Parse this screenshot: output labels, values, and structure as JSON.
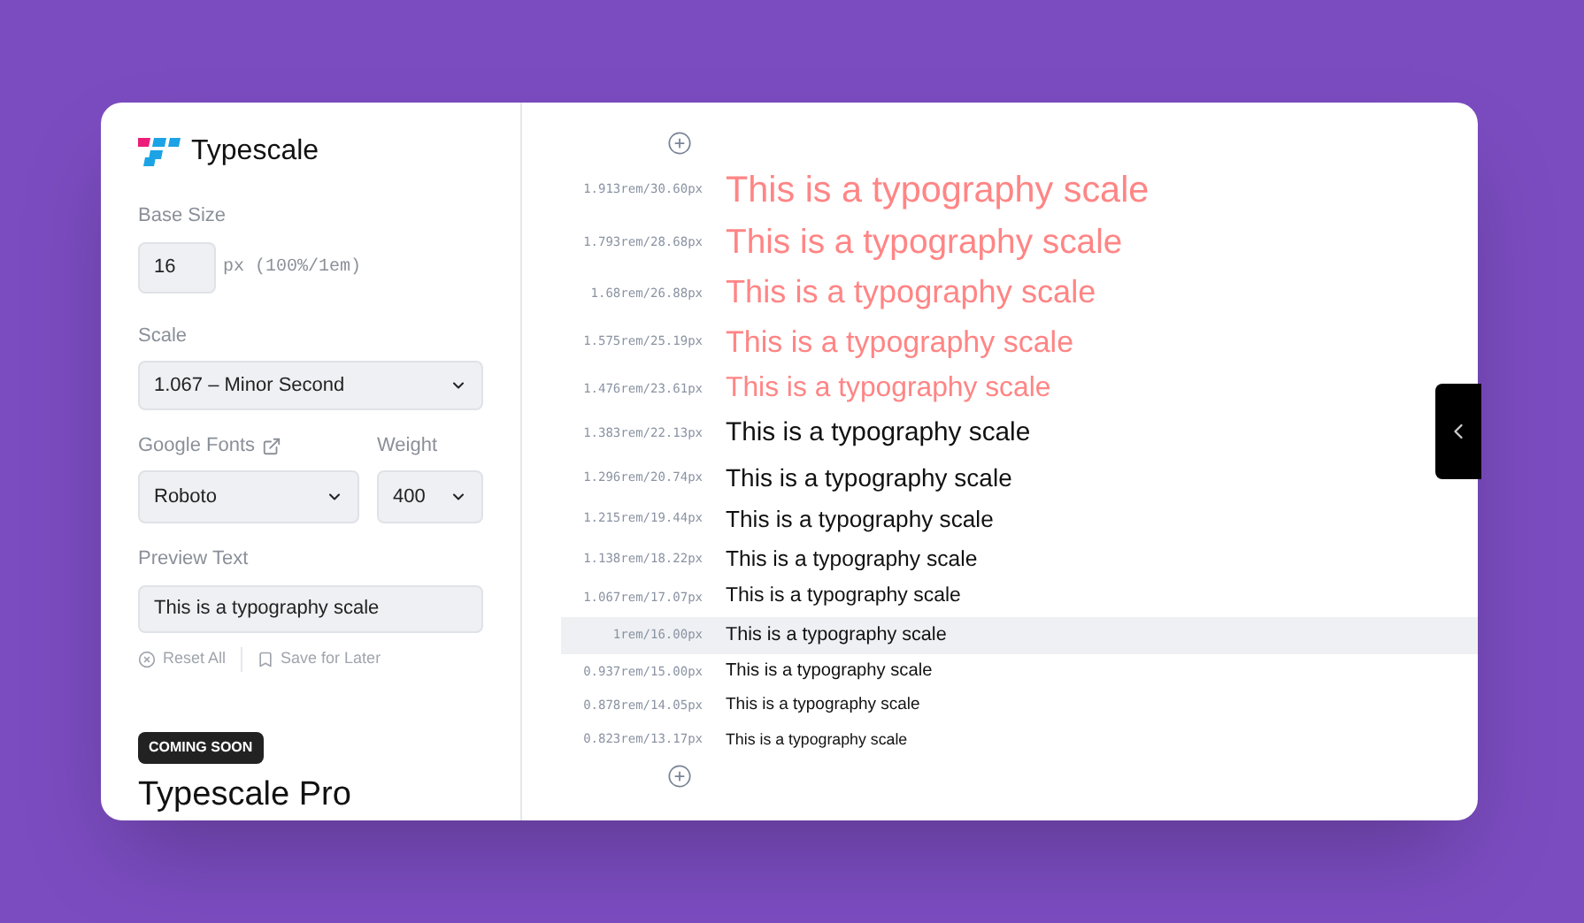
{
  "brand": "Typescale",
  "base_size": {
    "label": "Base Size",
    "value": "16",
    "unit": "px (100%/1em)"
  },
  "scale": {
    "label": "Scale",
    "value": "1.067 – Minor Second"
  },
  "font": {
    "label": "Google Fonts",
    "value": "Roboto"
  },
  "weight": {
    "label": "Weight",
    "value": "400"
  },
  "preview_text": {
    "label": "Preview Text",
    "value": "This is a typography scale"
  },
  "actions": [
    "Reset All",
    "Save for Later"
  ],
  "promo": {
    "badge": "COMING SOON",
    "title": "Typescale Pro"
  },
  "rows": [
    {
      "size": "1.913rem/30.60px",
      "text": "This is a typography scale",
      "warning": true,
      "selected": false
    },
    {
      "size": "1.793rem/28.68px",
      "text": "This is a typography scale",
      "warning": true,
      "selected": false
    },
    {
      "size": "1.68rem/26.88px",
      "text": "This is a typography scale",
      "warning": true,
      "selected": false
    },
    {
      "size": "1.575rem/25.19px",
      "text": "This is a typography scale",
      "warning": true,
      "selected": false
    },
    {
      "size": "1.476rem/23.61px",
      "text": "This is a typography scale",
      "warning": true,
      "selected": false
    },
    {
      "size": "1.383rem/22.13px",
      "text": "This is a typography scale",
      "warning": false,
      "selected": false
    },
    {
      "size": "1.296rem/20.74px",
      "text": "This is a typography scale",
      "warning": false,
      "selected": false
    },
    {
      "size": "1.215rem/19.44px",
      "text": "This is a typography scale",
      "warning": false,
      "selected": false
    },
    {
      "size": "1.138rem/18.22px",
      "text": "This is a typography scale",
      "warning": false,
      "selected": false
    },
    {
      "size": "1.067rem/17.07px",
      "text": "This is a typography scale",
      "warning": false,
      "selected": false
    },
    {
      "size": "1rem/16.00px",
      "text": "This is a typography scale",
      "warning": false,
      "selected": true
    },
    {
      "size": "0.937rem/15.00px",
      "text": "This is a typography scale",
      "warning": false,
      "selected": false
    },
    {
      "size": "0.878rem/14.05px",
      "text": "This is a typography scale",
      "warning": false,
      "selected": false
    },
    {
      "size": "0.823rem/13.17px",
      "text": "This is a typography scale",
      "warning": false,
      "selected": false
    }
  ]
}
